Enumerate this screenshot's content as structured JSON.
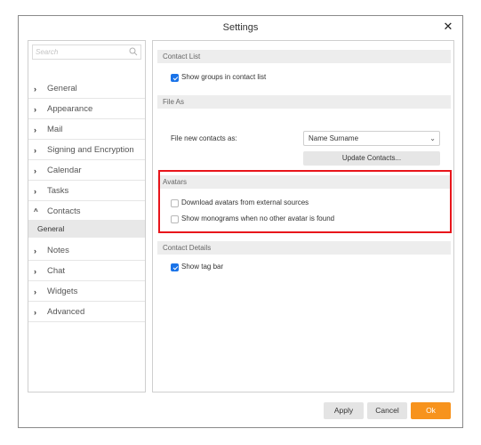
{
  "window": {
    "title": "Settings"
  },
  "sidebar": {
    "search_placeholder": "Search",
    "items": [
      {
        "label": "General"
      },
      {
        "label": "Appearance"
      },
      {
        "label": "Mail"
      },
      {
        "label": "Signing and Encryption"
      },
      {
        "label": "Calendar"
      },
      {
        "label": "Tasks"
      },
      {
        "label": "Contacts"
      },
      {
        "label": "Notes"
      },
      {
        "label": "Chat"
      },
      {
        "label": "Widgets"
      },
      {
        "label": "Advanced"
      }
    ],
    "active_sub": {
      "label": "General"
    }
  },
  "content": {
    "contact_list": {
      "header": "Contact List",
      "show_groups": {
        "label": "Show groups in contact list",
        "checked": true
      }
    },
    "file_as": {
      "header": "File As",
      "label": "File new contacts as:",
      "selected": "Name Surname",
      "update_button": "Update Contacts..."
    },
    "avatars": {
      "header": "Avatars",
      "download": {
        "label": "Download avatars from external sources",
        "checked": false
      },
      "monograms": {
        "label": "Show monograms when no other avatar is found",
        "checked": false
      }
    },
    "contact_details": {
      "header": "Contact Details",
      "show_tag_bar": {
        "label": "Show tag bar",
        "checked": true
      }
    }
  },
  "footer": {
    "apply": "Apply",
    "cancel": "Cancel",
    "ok": "Ok"
  },
  "colors": {
    "accent": "#1a73e8",
    "ok_button": "#f7931d",
    "highlight": "#e8151b"
  }
}
